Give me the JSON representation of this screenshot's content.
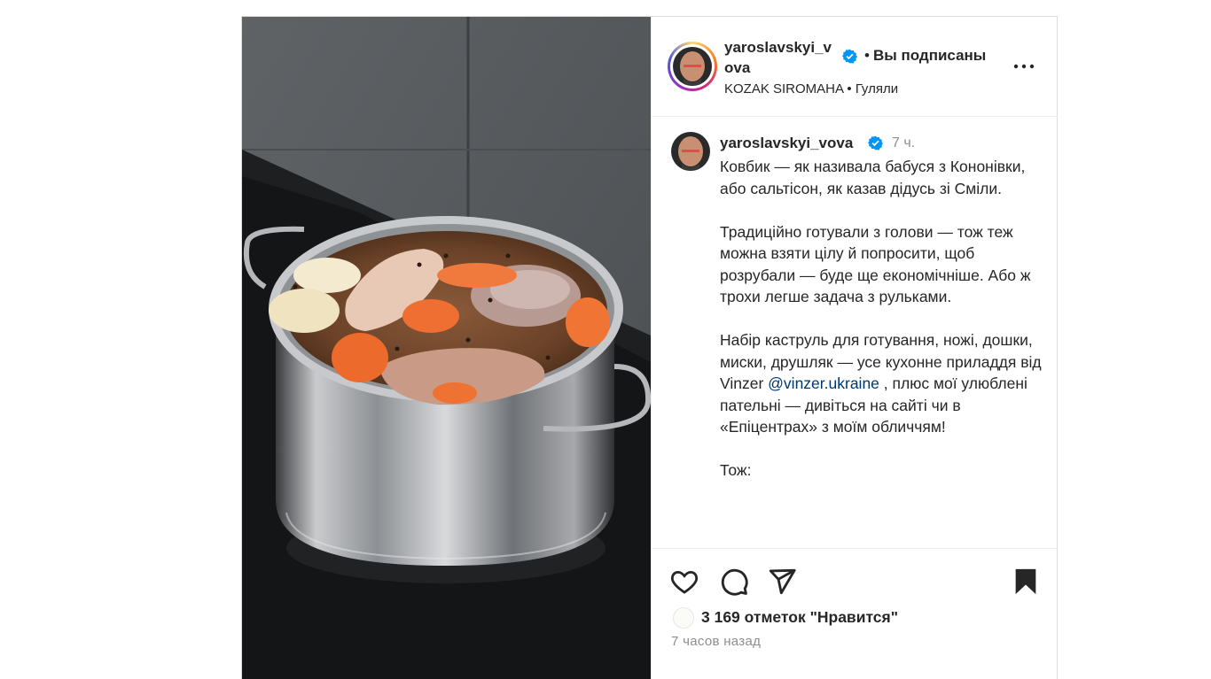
{
  "header": {
    "username": "yaroslavskyi_vova",
    "following_label": "Вы подписаны",
    "separator": "•",
    "subtitle_artist": "KOZAK SIROMAHA",
    "subtitle_song": "Гуляли"
  },
  "caption": {
    "username": "yaroslavskyi_vova",
    "time": "7 ч.",
    "paragraph1": "Ковбик — як називала бабуся з Кононівки, або сальтісон, як казав дідусь зі Сміли.",
    "paragraph2": "Традиційно готували з голови — тож теж можна взяти цілу й попросити, щоб розрубали — буде ще економічніше. Або ж трохи легше задача з рульками.",
    "paragraph3_before": "Набір каструль для готування, ножі, дошки, миски, друшляк — усе кухонне приладдя від Vinzer",
    "mention": "@vinzer.ukraine",
    "paragraph3_after": ", плюс мої улюблені пательні — дивіться на сайті чи в «Епіцентрах» з моїм обличчям!",
    "paragraph4": "Тож:"
  },
  "actions": {
    "likes_text": "3 169 отметок \"Нравится\"",
    "post_time": "7 часов назад"
  },
  "icons": {
    "verified": "verified-badge-icon",
    "more": "more-options-icon",
    "like": "heart-icon",
    "comment": "comment-icon",
    "share": "paper-plane-icon",
    "save": "bookmark-icon"
  },
  "colors": {
    "verified_blue": "#0095f6",
    "mention": "#00376b",
    "muted": "#8e8e8e",
    "text": "#262626"
  }
}
